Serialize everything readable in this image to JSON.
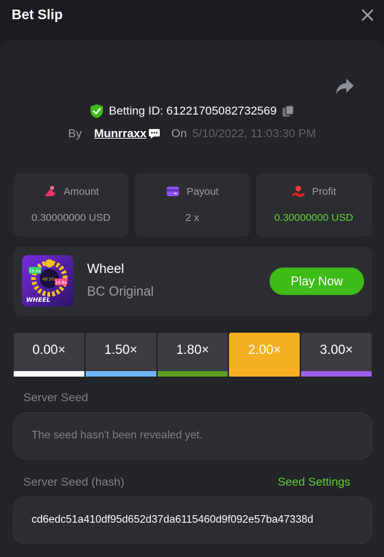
{
  "header": {
    "title": "Bet Slip"
  },
  "bet": {
    "betting_id_text": "Betting ID: 61221705082732569",
    "by_label": "By",
    "username": "Munrraxx",
    "on_label": "On",
    "date": "5/10/2022, 11:03:30 PM"
  },
  "stats": [
    {
      "label": "Amount",
      "value": "0.30000000 USD"
    },
    {
      "label": "Payout",
      "value": "2 x"
    },
    {
      "label": "Profit",
      "value": "0.30000000 USD"
    }
  ],
  "game": {
    "name": "Wheel",
    "subtitle": "BC Original",
    "play_label": "Play Now",
    "thumb_text": "WHEEL",
    "thumb_badges": [
      "19.6x",
      "49.50x",
      "19.8x"
    ]
  },
  "multipliers": [
    {
      "label": "0.00×",
      "bar_color": "#ffffff",
      "active": false
    },
    {
      "label": "1.50×",
      "bar_color": "#6fb6f8",
      "active": false
    },
    {
      "label": "1.80×",
      "bar_color": "#5c9e1c",
      "active": false
    },
    {
      "label": "2.00×",
      "bar_color": "#f5b021",
      "active": true
    },
    {
      "label": "3.00×",
      "bar_color": "#9c5ee6",
      "active": false
    }
  ],
  "server_seed": {
    "label": "Server Seed",
    "value": "The seed hasn't been revealed yet."
  },
  "server_seed_hash": {
    "label": "Server Seed (hash)",
    "settings_label": "Seed Settings",
    "value": "cd6edc51a410df95d652d37da6115460d9f092e57ba47338d"
  },
  "colors": {
    "accent_green": "#3dbb17",
    "profit_green": "#5fd13a",
    "active_multiplier": "#f5b021"
  }
}
